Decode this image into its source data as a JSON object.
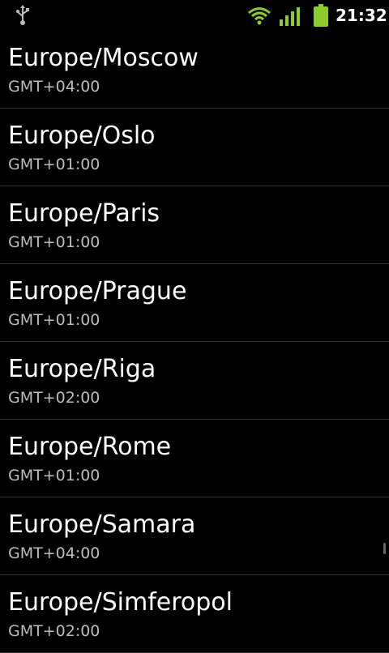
{
  "status_bar": {
    "time": "21:32",
    "icons": [
      "usb-icon",
      "wifi-icon",
      "signal-icon",
      "battery-icon"
    ],
    "accent_color": "#8ccc2c"
  },
  "timezones": [
    {
      "name": "Europe/Moscow",
      "offset": "GMT+04:00"
    },
    {
      "name": "Europe/Oslo",
      "offset": "GMT+01:00"
    },
    {
      "name": "Europe/Paris",
      "offset": "GMT+01:00"
    },
    {
      "name": "Europe/Prague",
      "offset": "GMT+01:00"
    },
    {
      "name": "Europe/Riga",
      "offset": "GMT+02:00"
    },
    {
      "name": "Europe/Rome",
      "offset": "GMT+01:00"
    },
    {
      "name": "Europe/Samara",
      "offset": "GMT+04:00"
    },
    {
      "name": "Europe/Simferopol",
      "offset": "GMT+02:00"
    }
  ]
}
